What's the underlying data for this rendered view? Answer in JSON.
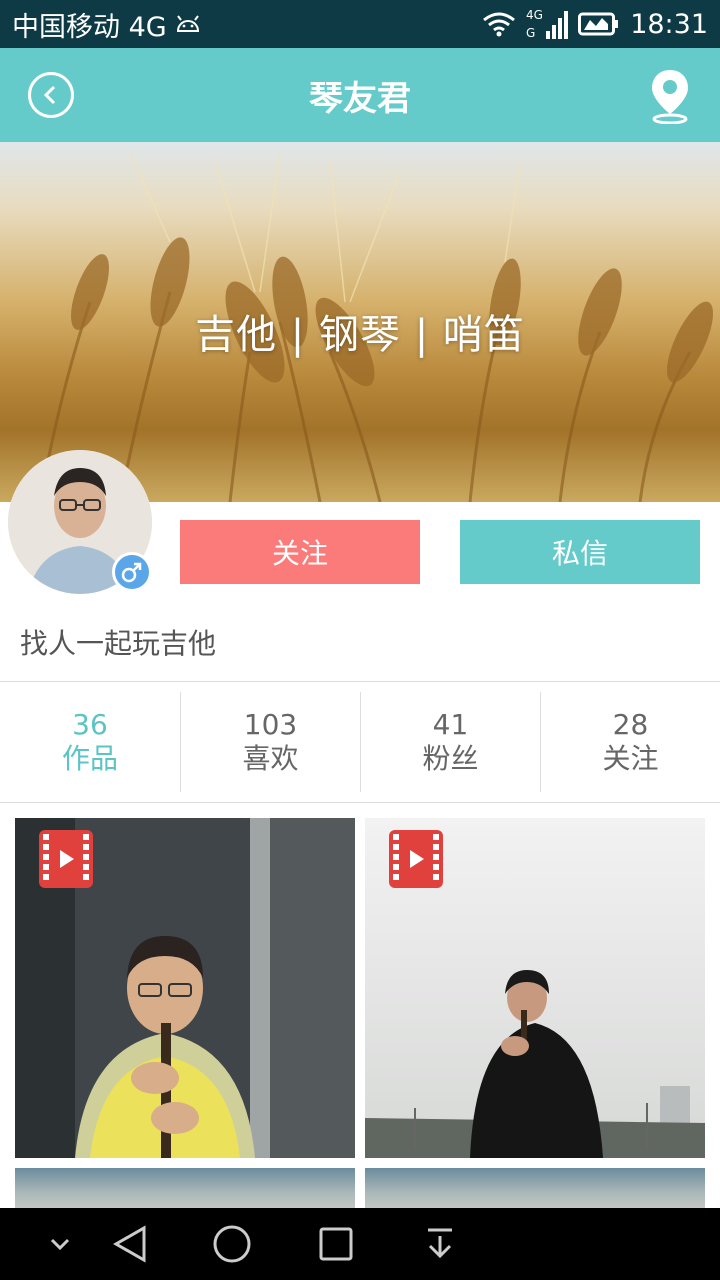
{
  "status_bar": {
    "carrier": "中国移动 4G",
    "network": "4G",
    "time": "18:31"
  },
  "header": {
    "title": "琴友君",
    "back_icon": "back-circle-icon",
    "location_icon": "location-pin-icon"
  },
  "banner": {
    "text": "吉他 | 钢琴  | 哨笛"
  },
  "profile": {
    "gender": "male",
    "follow_label": "关注",
    "message_label": "私信",
    "bio": "找人一起玩吉他"
  },
  "stats": [
    {
      "count": "36",
      "label": "作品"
    },
    {
      "count": "103",
      "label": "喜欢"
    },
    {
      "count": "41",
      "label": "粉丝"
    },
    {
      "count": "28",
      "label": "关注"
    }
  ],
  "colors": {
    "accent": "#65cbca",
    "follow": "#fb7a7a",
    "status_bar": "#0d3a44",
    "gender_badge": "#5aa6e8",
    "video_badge": "#e0413c"
  },
  "works": [
    {
      "type": "video",
      "icon": "video-play-icon"
    },
    {
      "type": "video",
      "icon": "video-play-icon"
    }
  ],
  "nav": [
    "chevron-down-icon",
    "back-triangle-icon",
    "home-circle-icon",
    "recents-square-icon",
    "download-icon"
  ]
}
